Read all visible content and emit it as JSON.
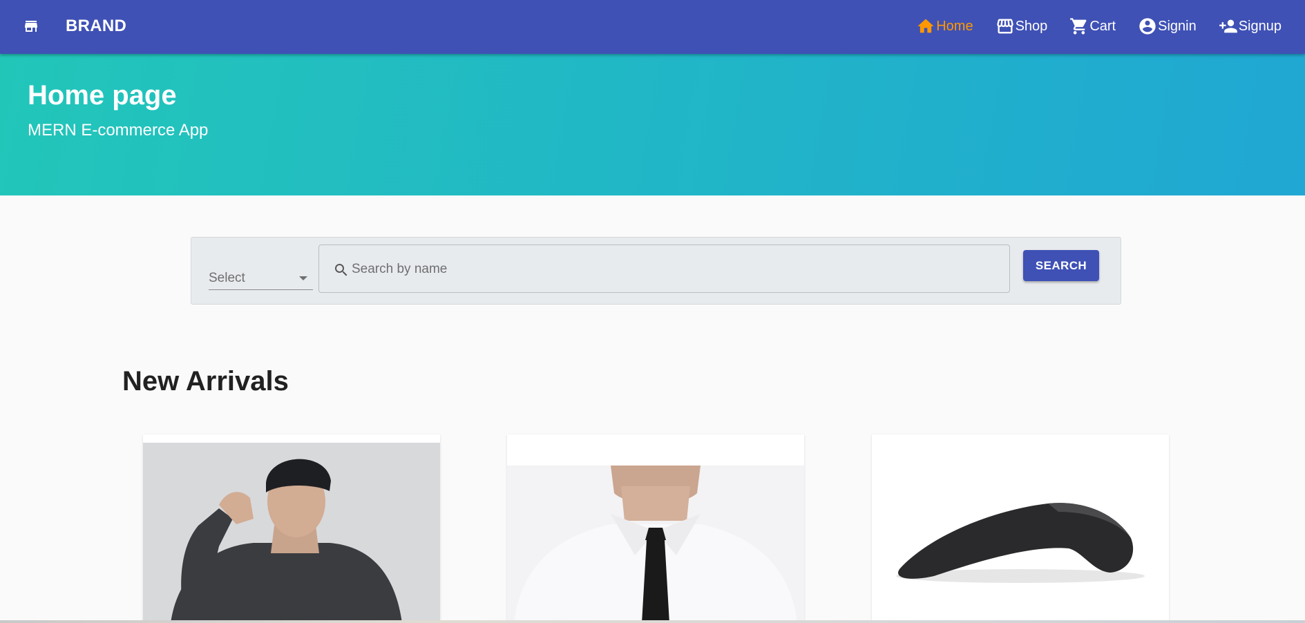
{
  "appbar": {
    "brand": "BRAND",
    "bg_color": "#3f51b5",
    "active_color": "#ff9800",
    "nav": [
      {
        "label": "Home",
        "icon": "home-icon",
        "active": true
      },
      {
        "label": "Shop",
        "icon": "storefront-icon",
        "active": false
      },
      {
        "label": "Cart",
        "icon": "cart-icon",
        "active": false
      },
      {
        "label": "Signin",
        "icon": "account-circle-icon",
        "active": false
      },
      {
        "label": "Signup",
        "icon": "person-add-icon",
        "active": false
      }
    ]
  },
  "hero": {
    "title": "Home page",
    "subtitle": "MERN E-commerce App"
  },
  "search": {
    "category_select": "Select",
    "placeholder": "Search by name",
    "button_label": "SEARCH"
  },
  "section": {
    "title": "New Arrivals"
  },
  "products": [
    {
      "image": "man in black cap and dark t-shirt"
    },
    {
      "image": "man in white shirt and black tie"
    },
    {
      "image": "black wireless arc mouse"
    }
  ]
}
